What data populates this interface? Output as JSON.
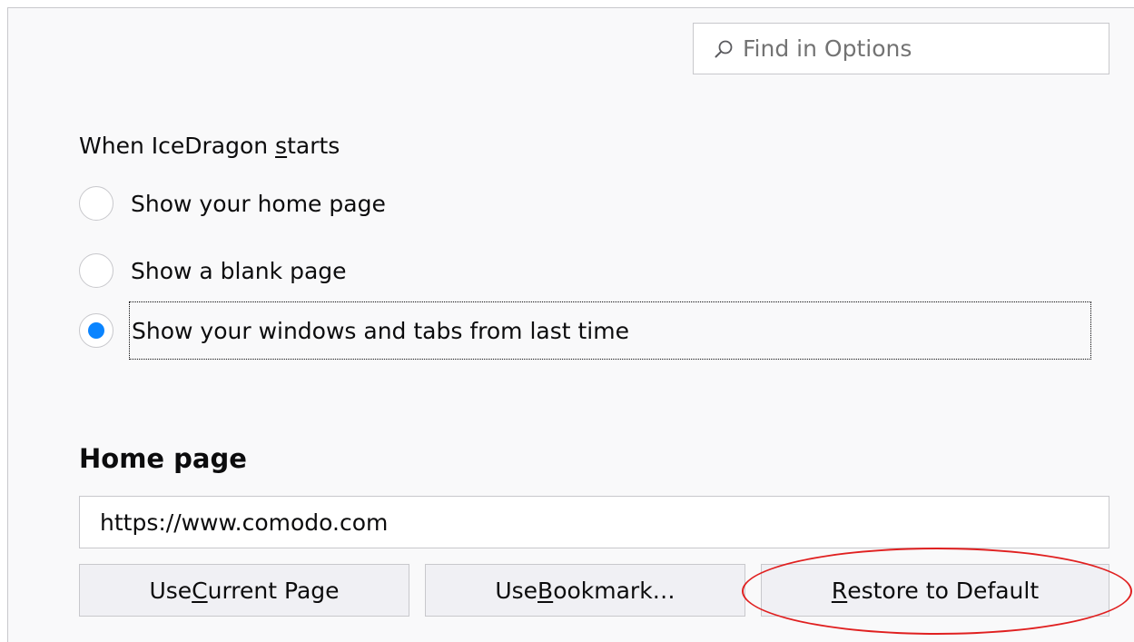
{
  "search": {
    "placeholder": "Find in Options",
    "icon": "search-icon"
  },
  "startup": {
    "label_before": "When IceDragon ",
    "label_accel": "s",
    "label_after": "tarts",
    "options": [
      {
        "label": "Show your home page",
        "selected": false
      },
      {
        "label": "Show a blank page",
        "selected": false
      },
      {
        "label": "Show your windows and tabs from last time",
        "selected": true
      }
    ]
  },
  "home": {
    "heading": "Home page",
    "url": "https://www.comodo.com"
  },
  "buttons": {
    "use_current": {
      "before": "Use ",
      "accel": "C",
      "after": "urrent Page"
    },
    "use_bookmark": {
      "before": "Use ",
      "accel": "B",
      "after": "ookmark…"
    },
    "restore": {
      "before": "",
      "accel": "R",
      "after": "estore to Default"
    }
  },
  "colors": {
    "accent": "#0a84ff",
    "annotation": "#e02020"
  }
}
